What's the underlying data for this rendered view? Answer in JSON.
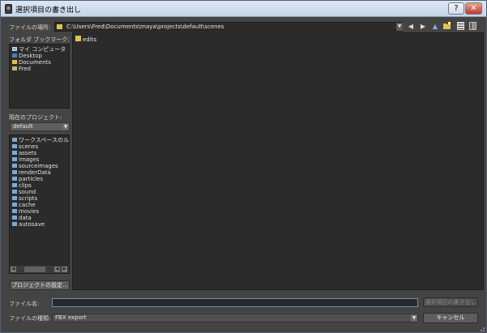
{
  "window": {
    "title": "選択項目の書き出し",
    "help_label": "?",
    "close_label": "✕"
  },
  "toolbar": {
    "location_label": "ファイルの場所:",
    "path": "C:\\Users\\Fred\\Documents\\maya\\projects\\default\\scenes"
  },
  "bookmarks": {
    "label": "フォルダ ブックマーク:",
    "items": [
      "マイ コンピュータ",
      "Desktop",
      "Documents",
      "Fred"
    ]
  },
  "project": {
    "label": "現在のプロジェクト:",
    "current": "default",
    "folders": [
      "ワークスペースのル",
      "scenes",
      "assets",
      "images",
      "sourceimages",
      "renderData",
      "particles",
      "clips",
      "sound",
      "scripts",
      "cache",
      "movies",
      "data",
      "autosave"
    ],
    "settings_button": "プロジェクトの設定..."
  },
  "files": {
    "items": [
      "edits"
    ]
  },
  "footer": {
    "filename_label": "ファイル名:",
    "filename_value": "",
    "filetype_label": "ファイルの種類:",
    "filetype_value": "FBX export",
    "export_button": "選択項目の書き出し",
    "cancel_button": "キャンセル"
  },
  "colors": {
    "window_bg": "#444444",
    "panel_bg": "#2b2b2b",
    "folder": "#e2c250",
    "accent": "#6f8fb0"
  }
}
